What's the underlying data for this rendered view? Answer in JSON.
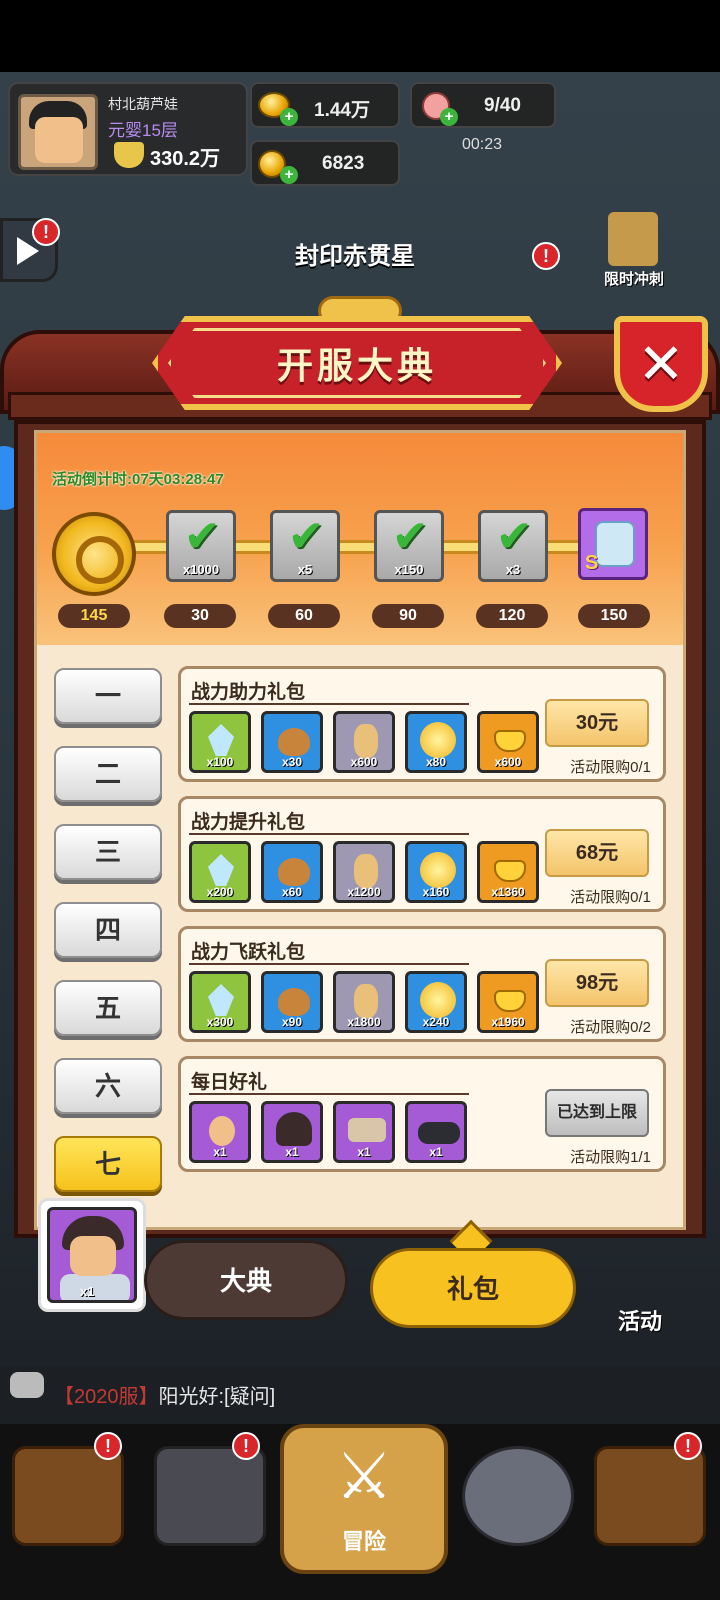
{
  "player": {
    "name": "村北葫芦娃",
    "rank": "元婴15层",
    "power": "330.2万"
  },
  "resources": {
    "ingot": "1.44万",
    "copper": "6823",
    "stamina": "9/40",
    "stamina_timer": "00:23"
  },
  "top_event": {
    "title": "封印赤贯星",
    "limited_label": "限时冲刺"
  },
  "modal": {
    "title": "开服大典",
    "countdown_label": "活动倒计时:",
    "countdown_value": "07天03:28:47",
    "current_points": "145",
    "milestones": [
      {
        "points": "30",
        "qty": "x1000",
        "claimed": true
      },
      {
        "points": "60",
        "qty": "x5",
        "claimed": true
      },
      {
        "points": "90",
        "qty": "x150",
        "claimed": true
      },
      {
        "points": "120",
        "qty": "x3",
        "claimed": true
      },
      {
        "points": "150",
        "grade": "S",
        "claimed": false
      }
    ],
    "tabs": [
      "一",
      "二",
      "三",
      "四",
      "五",
      "六",
      "七"
    ],
    "active_tab": "七",
    "packs": [
      {
        "title": "战力助力礼包",
        "price": "30元",
        "limit": "活动限购0/1",
        "items": [
          {
            "icon": "crystal",
            "qty": "x100"
          },
          {
            "icon": "pouch",
            "qty": "x30"
          },
          {
            "icon": "doll",
            "qty": "x600"
          },
          {
            "icon": "golden-orb",
            "qty": "x80"
          },
          {
            "icon": "gold-ingot",
            "qty": "x600"
          }
        ]
      },
      {
        "title": "战力提升礼包",
        "price": "68元",
        "limit": "活动限购0/1",
        "items": [
          {
            "icon": "crystal",
            "qty": "x200"
          },
          {
            "icon": "pouch",
            "qty": "x60"
          },
          {
            "icon": "doll",
            "qty": "x1200"
          },
          {
            "icon": "golden-orb",
            "qty": "x160"
          },
          {
            "icon": "gold-ingot",
            "qty": "x1360"
          }
        ]
      },
      {
        "title": "战力飞跃礼包",
        "price": "98元",
        "limit": "活动限购0/2",
        "items": [
          {
            "icon": "crystal",
            "qty": "x300"
          },
          {
            "icon": "pouch",
            "qty": "x90"
          },
          {
            "icon": "doll",
            "qty": "x1800"
          },
          {
            "icon": "golden-orb",
            "qty": "x240"
          },
          {
            "icon": "gold-ingot",
            "qty": "x1960"
          }
        ]
      },
      {
        "title": "每日好礼",
        "price": "已达到上限",
        "limit": "活动限购1/1",
        "items": [
          {
            "icon": "bald-head",
            "qty": "x1"
          },
          {
            "icon": "hair",
            "qty": "x1"
          },
          {
            "icon": "armor",
            "qty": "x1"
          },
          {
            "icon": "boots",
            "qty": "x1"
          }
        ]
      }
    ],
    "hero_qty": "x1"
  },
  "bottom_tabs": {
    "grand": "大典",
    "gift": "礼包"
  },
  "activity_label": "活动",
  "chat": {
    "server": "【2020服】",
    "message": "阳光好:[疑问]"
  },
  "nav": {
    "adventure": "冒险"
  }
}
